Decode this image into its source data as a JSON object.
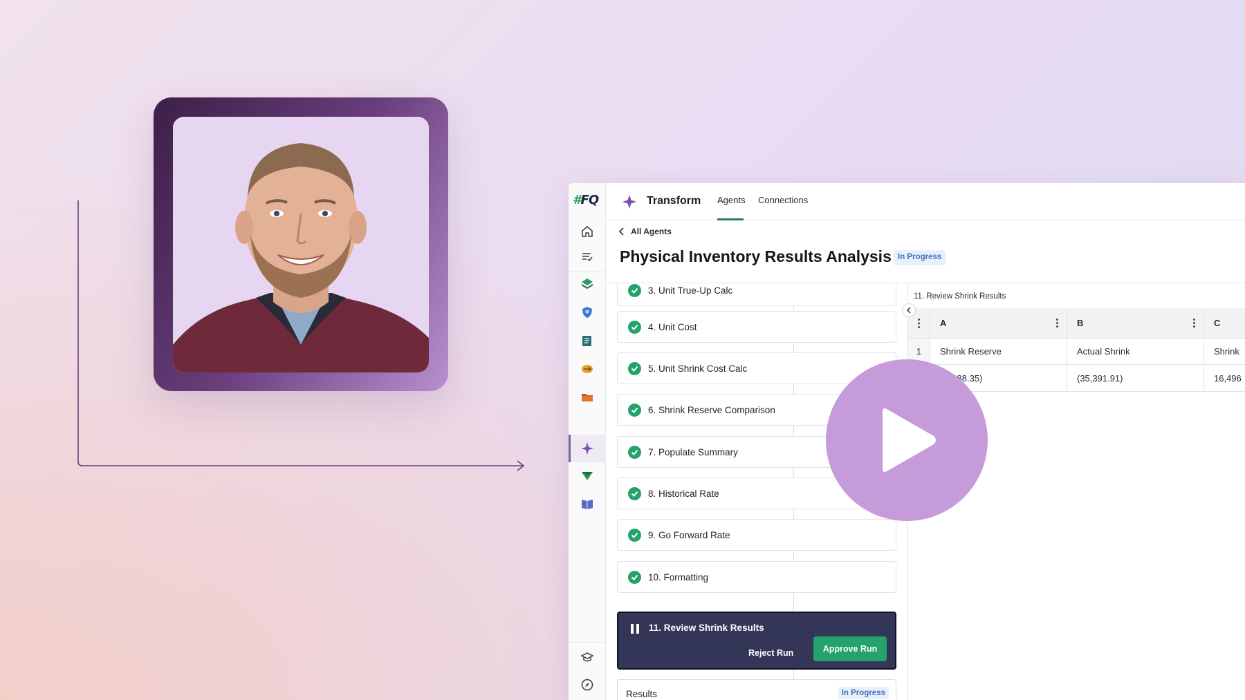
{
  "colors": {
    "accent_green": "#23a36b",
    "active_step_bg": "#333656",
    "play_button": "#c59bd9",
    "status_blue": "#3e6fbf"
  },
  "rail": {
    "logo": "FQ",
    "icons": [
      "home-icon",
      "task-list-icon",
      "ledger-icon",
      "shield-icon",
      "reports-icon",
      "reconcile-icon",
      "folder-icon",
      "transform-icon",
      "send-icon",
      "book-icon",
      "learn-icon",
      "compass-icon"
    ]
  },
  "topbar": {
    "brand": "Transform",
    "tabs": [
      {
        "label": "Agents",
        "active": true
      },
      {
        "label": "Connections",
        "active": false
      }
    ]
  },
  "breadcrumb": "All Agents",
  "page_title": "Physical Inventory Results Analysis",
  "status": "In Progress",
  "steps": [
    {
      "label": "3. Unit True-Up Calc",
      "done": true
    },
    {
      "label": "4. Unit Cost",
      "done": true
    },
    {
      "label": "5. Unit Shrink Cost Calc",
      "done": true
    },
    {
      "label": "6. Shrink Reserve Comparison",
      "done": true
    },
    {
      "label": "7. Populate Summary",
      "done": true
    },
    {
      "label": "8. Historical Rate",
      "done": true
    },
    {
      "label": "9. Go Forward Rate",
      "done": true
    },
    {
      "label": "10. Formatting",
      "done": true
    }
  ],
  "active_step": {
    "label": "11. Review Shrink Results",
    "reject_label": "Reject Run",
    "approve_label": "Approve Run"
  },
  "results": {
    "label": "Results",
    "status": "In Progress"
  },
  "sheet": {
    "name": "11. Review Shrink Results",
    "columns": [
      "A",
      "B",
      "C"
    ],
    "rows": [
      {
        "num": "1",
        "cells": [
          "Shrink Reserve",
          "Actual Shrink",
          "Shrink"
        ]
      },
      {
        "num": "",
        "cells": [
          "(…888.35)",
          "(35,391.91)",
          "16,496"
        ]
      }
    ]
  },
  "video": {
    "play_icon": "play-icon"
  }
}
